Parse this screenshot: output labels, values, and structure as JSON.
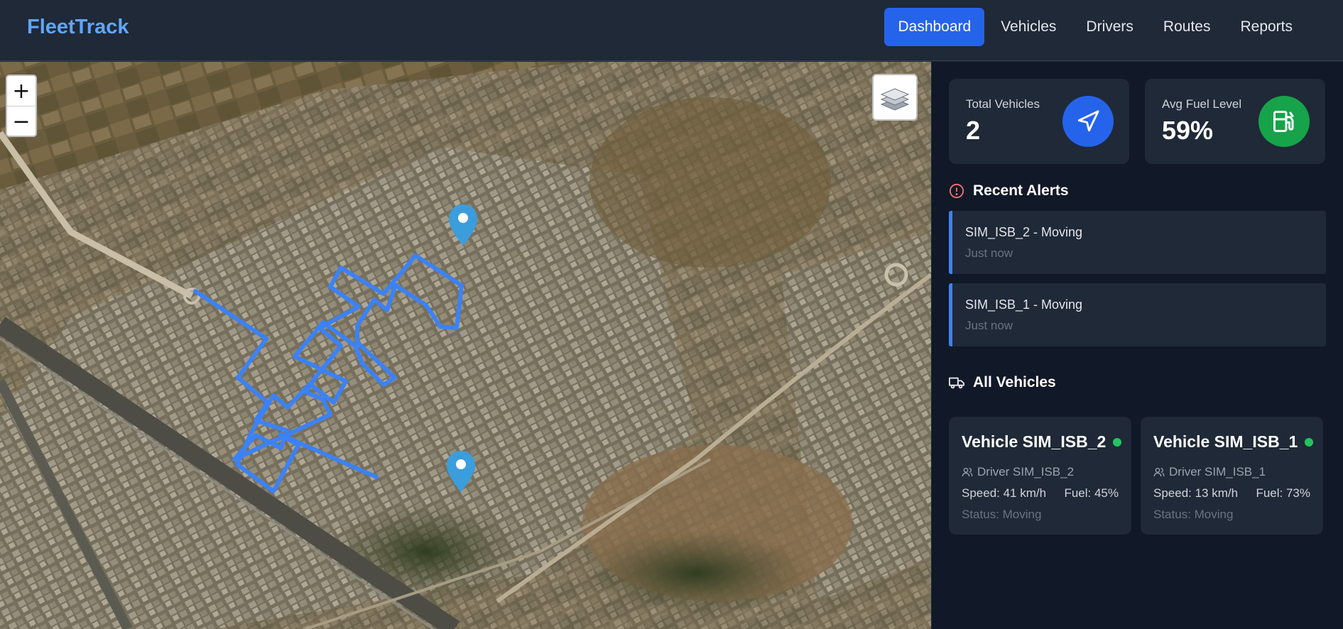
{
  "app": {
    "brand": "FleetTrack"
  },
  "nav": {
    "items": [
      {
        "label": "Dashboard",
        "active": true
      },
      {
        "label": "Vehicles",
        "active": false
      },
      {
        "label": "Drivers",
        "active": false
      },
      {
        "label": "Routes",
        "active": false
      },
      {
        "label": "Reports",
        "active": false
      }
    ]
  },
  "map": {
    "zoom_in": "+",
    "zoom_out": "−",
    "layers_icon": "layers-icon",
    "route_color": "#3b82f6",
    "marker_color": "#3b9ddc"
  },
  "stats": {
    "total_vehicles": {
      "label": "Total Vehicles",
      "value": "2",
      "icon": "navigation-arrow-icon",
      "color": "#2563eb"
    },
    "avg_fuel": {
      "label": "Avg Fuel Level",
      "value": "59%",
      "icon": "fuel-pump-icon",
      "color": "#16a34a"
    }
  },
  "alerts": {
    "title": "Recent Alerts",
    "icon": "alert-circle-icon",
    "items": [
      {
        "title": "SIM_ISB_2 - Moving",
        "time": "Just now"
      },
      {
        "title": "SIM_ISB_1 - Moving",
        "time": "Just now"
      }
    ]
  },
  "vehicles": {
    "title": "All Vehicles",
    "icon": "truck-icon",
    "items": [
      {
        "name": "Vehicle SIM_ISB_2",
        "driver": "Driver SIM_ISB_2",
        "speed": "Speed: 41 km/h",
        "fuel": "Fuel: 45%",
        "status": "Status: Moving",
        "online_color": "#22c55e"
      },
      {
        "name": "Vehicle SIM_ISB_1",
        "driver": "Driver SIM_ISB_1",
        "speed": "Speed: 13 km/h",
        "fuel": "Fuel: 73%",
        "status": "Status: Moving",
        "online_color": "#22c55e"
      }
    ]
  }
}
